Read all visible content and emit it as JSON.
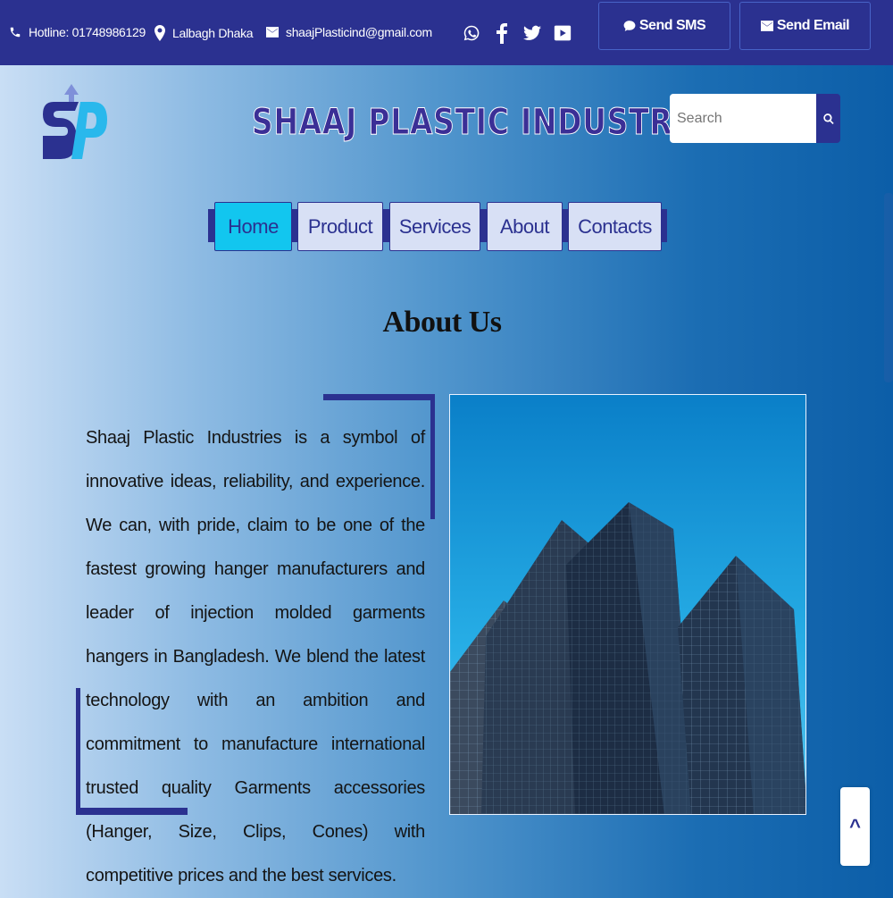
{
  "topbar": {
    "hotline": "Hotline: 01748986129",
    "location": "Lalbagh Dhaka",
    "email": "shaajPlasticind@gmail.com",
    "social": [
      "whatsapp-icon",
      "facebook-icon",
      "twitter-icon",
      "youtube-icon"
    ],
    "send_sms": "Send SMS",
    "send_email": "Send Email"
  },
  "header": {
    "logo_text": "SP",
    "brand": "SHAAJ PLASTIC INDUSTRIES",
    "search_placeholder": "Search"
  },
  "nav": {
    "items": [
      {
        "label": "Home",
        "active": true
      },
      {
        "label": "Product"
      },
      {
        "label": "Services"
      },
      {
        "label": "About"
      },
      {
        "label": "Contacts"
      }
    ]
  },
  "about": {
    "title": "About Us",
    "body": "Shaaj Plastic Industries is a symbol of innovative ideas, reliability, and experience. We can, with pride, claim to be one of the fastest growing hanger manufacturers and leader of injection molded garments hangers in Bangladesh. We blend the latest technology with an ambition and commitment to manufacture international trusted quality Garments accessories (Hanger, Size, Clips, Cones) with competitive prices and the best services."
  },
  "scroll_top": "^",
  "colors": {
    "primary": "#2b3190",
    "nav_active": "#12c6ef",
    "nav_bg": "#d8e0f5"
  }
}
